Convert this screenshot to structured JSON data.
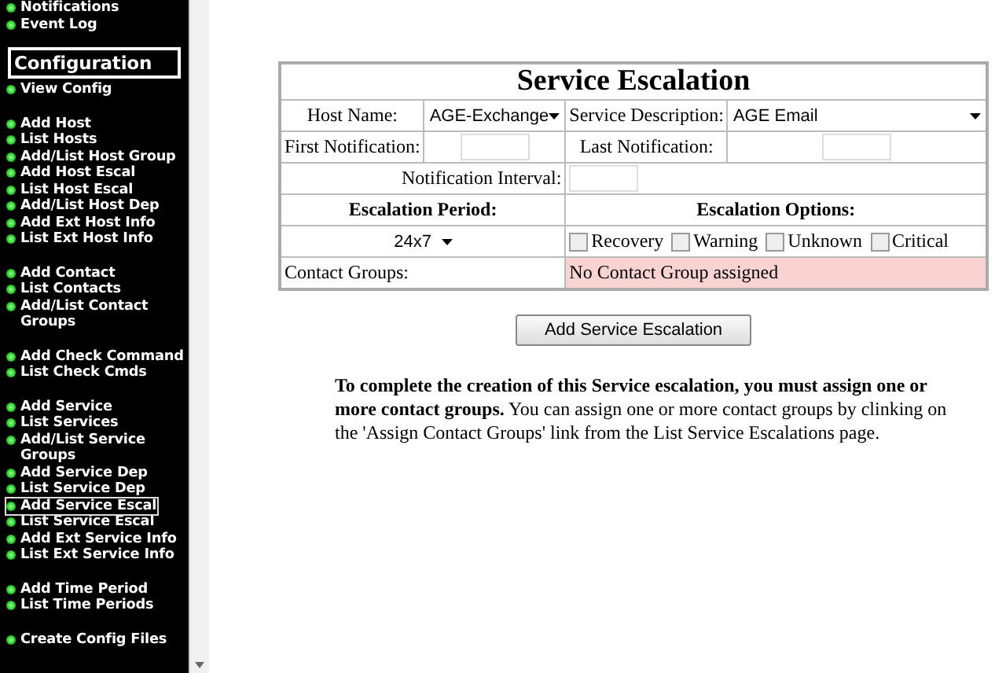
{
  "sidebar": {
    "top_items": [
      {
        "label": "Notifications",
        "selected": false
      },
      {
        "label": "Event Log",
        "selected": false
      }
    ],
    "heading": "Configuration",
    "groups": [
      {
        "items": [
          {
            "label": "View Config",
            "selected": false
          }
        ]
      },
      {
        "items": [
          {
            "label": "Add Host",
            "selected": false
          },
          {
            "label": "List Hosts",
            "selected": false
          },
          {
            "label": "Add/List Host Group",
            "selected": false
          },
          {
            "label": "Add Host Escal",
            "selected": false
          },
          {
            "label": "List Host Escal",
            "selected": false
          },
          {
            "label": "Add/List Host Dep",
            "selected": false
          },
          {
            "label": "Add Ext Host Info",
            "selected": false
          },
          {
            "label": "List Ext Host Info",
            "selected": false
          }
        ]
      },
      {
        "items": [
          {
            "label": "Add Contact",
            "selected": false
          },
          {
            "label": "List Contacts",
            "selected": false
          },
          {
            "label": "Add/List Contact Groups",
            "selected": false
          }
        ]
      },
      {
        "items": [
          {
            "label": "Add Check Command",
            "selected": false
          },
          {
            "label": "List Check Cmds",
            "selected": false
          }
        ]
      },
      {
        "items": [
          {
            "label": "Add Service",
            "selected": false
          },
          {
            "label": "List Services",
            "selected": false
          },
          {
            "label": "Add/List Service Groups",
            "selected": false
          },
          {
            "label": "Add Service Dep",
            "selected": false
          },
          {
            "label": "List Service Dep",
            "selected": false
          },
          {
            "label": "Add Service Escal",
            "selected": true
          },
          {
            "label": "List Service Escal",
            "selected": false
          },
          {
            "label": "Add Ext Service Info",
            "selected": false
          },
          {
            "label": "List Ext Service Info",
            "selected": false
          }
        ]
      },
      {
        "items": [
          {
            "label": "Add Time Period",
            "selected": false
          },
          {
            "label": "List Time Periods",
            "selected": false
          }
        ]
      },
      {
        "items": [
          {
            "label": "Create Config Files",
            "selected": false
          }
        ]
      }
    ]
  },
  "form": {
    "title": "Service Escalation",
    "host_name": {
      "label": "Host Name:",
      "value": "AGE-Exchange"
    },
    "service_description": {
      "label": "Service Description:",
      "value": "AGE Email"
    },
    "first_notification": {
      "label": "First Notification:"
    },
    "last_notification": {
      "label": "Last Notification:"
    },
    "notification_interval": {
      "label": "Notification Interval:"
    },
    "escalation_period": {
      "label": "Escalation Period:",
      "value": "24x7"
    },
    "escalation_options": {
      "label": "Escalation Options:",
      "options": [
        {
          "label": "Recovery",
          "checked": false
        },
        {
          "label": "Warning",
          "checked": false
        },
        {
          "label": "Unknown",
          "checked": false
        },
        {
          "label": "Critical",
          "checked": false
        }
      ]
    },
    "contact_groups": {
      "label": "Contact Groups:",
      "value": "No Contact Group assigned"
    },
    "submit": "Add Service Escalation"
  },
  "note": "**To complete the creation of this Service escalation, you must assign one or more contact groups.** You can assign one or more contact groups by clinking on the 'Assign Contact Groups' link from the List Service Escalations page."
}
